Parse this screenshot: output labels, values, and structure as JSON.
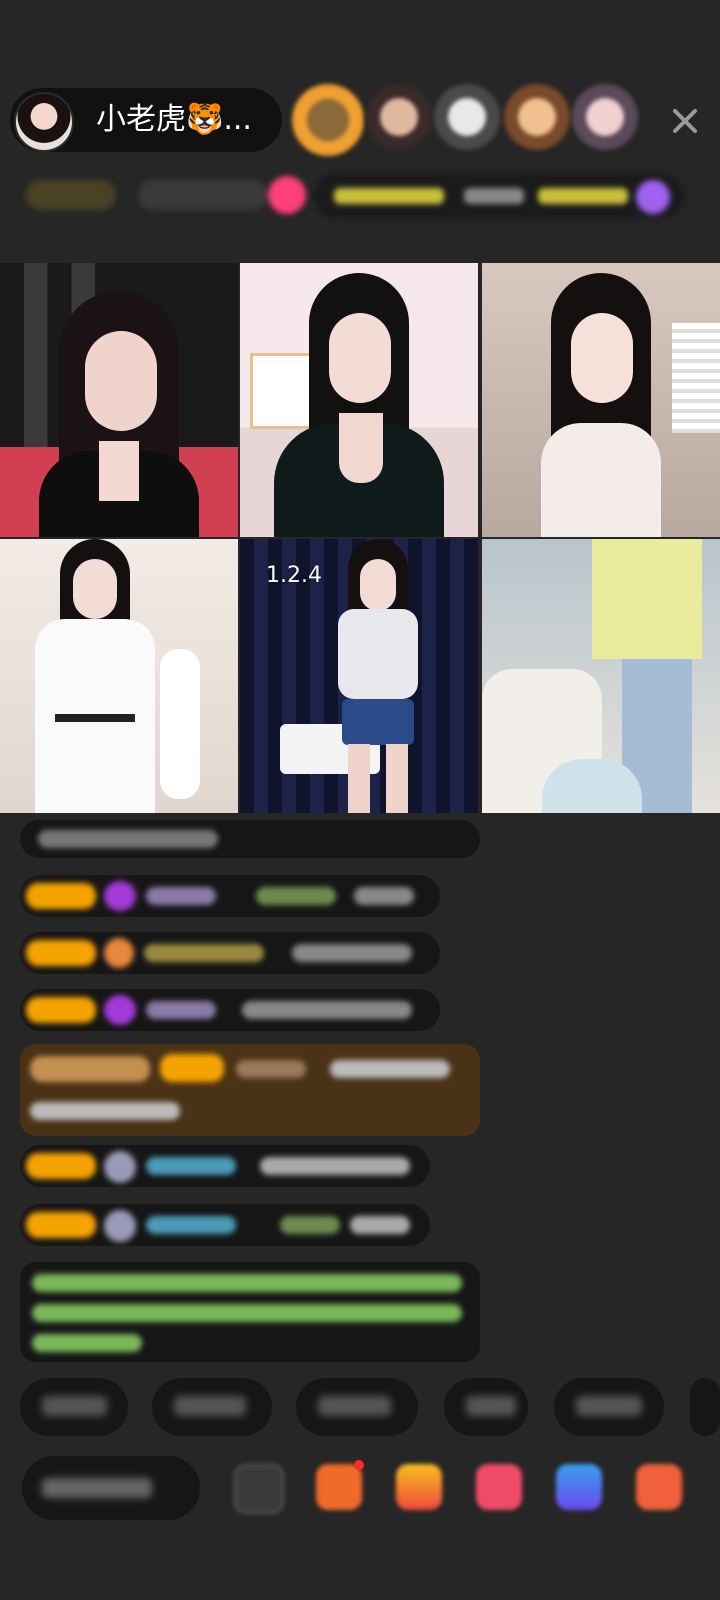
{
  "host": {
    "name": "小老虎🐯..."
  },
  "close": {
    "icon": "close-icon"
  },
  "video_grid": {
    "cells": [
      {
        "label": ""
      },
      {
        "label": ""
      },
      {
        "label": ""
      },
      {
        "label": ""
      },
      {
        "label": "1.2.4"
      },
      {
        "label": ""
      }
    ]
  },
  "colors": {
    "background": "#262626",
    "badge_yellow": "#f5a300",
    "chat_bg": "#141414",
    "highlight_bg": "#5a3a16",
    "chat_green": "#9fdc7a"
  }
}
